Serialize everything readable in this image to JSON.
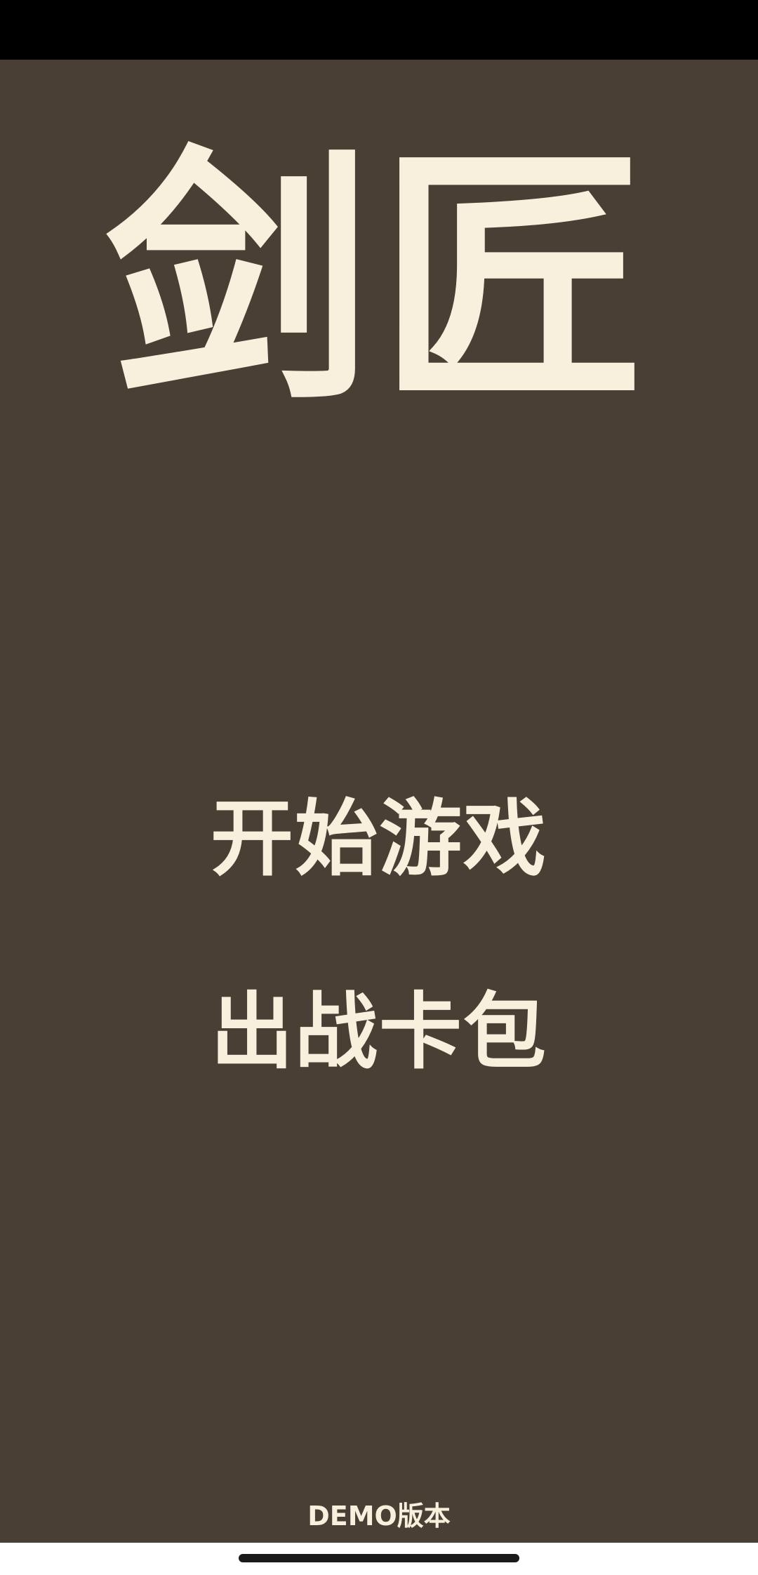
{
  "game": {
    "title": "剑匠",
    "menu": {
      "start_label": "开始游戏",
      "deck_label": "出战卡包"
    },
    "version_label": "DEMO版本"
  },
  "colors": {
    "background": "#4a3f35",
    "text": "#f8f0dc",
    "status_bar": "#000000"
  }
}
